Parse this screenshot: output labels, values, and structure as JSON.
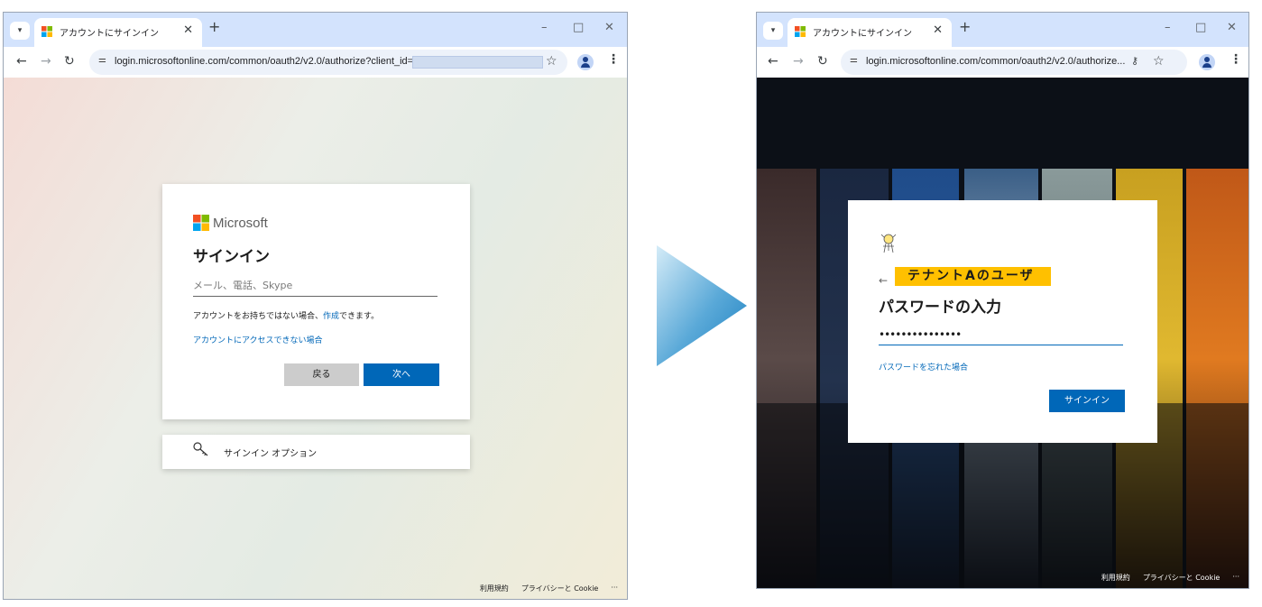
{
  "left_window": {
    "tab_title": "アカウントにサインイン",
    "url": "login.microsoftonline.com/common/oauth2/v2.0/authorize?client_id=",
    "card": {
      "brand": "Microsoft",
      "title": "サインイン",
      "email_placeholder": "メール、電話、Skype",
      "no_account_prefix": "アカウントをお持ちではない場合、",
      "create_link": "作成",
      "no_account_suffix": "できます。",
      "cant_access_link": "アカウントにアクセスできない場合",
      "back_button": "戻る",
      "next_button": "次へ"
    },
    "signin_options": "サインイン オプション",
    "footer": {
      "terms": "利用規約",
      "privacy": "プライバシーと Cookie",
      "more": "···"
    }
  },
  "right_window": {
    "tab_title": "アカウントにサインイン",
    "url": "login.microsoftonline.com/common/oauth2/v2.0/authorize...",
    "card": {
      "tenant_label": "テナントAのユーザ",
      "title": "パスワードの入力",
      "password_value": "•••••••••••••••",
      "forgot_link": "パスワードを忘れた場合",
      "signin_button": "サインイン"
    },
    "footer": {
      "terms": "利用規約",
      "privacy": "プライバシーと Cookie",
      "more": "···"
    }
  },
  "browser": {
    "back_icon": "arrow-left-icon",
    "forward_icon": "arrow-right-icon",
    "reload_icon": "reload-icon",
    "new_tab": "+",
    "minimize": "–",
    "maximize": "□",
    "close": "✕"
  },
  "colors": {
    "accent": "#0067b8",
    "tenant_highlight": "#ffc000",
    "tabbar": "#d3e3fd",
    "arrow_light": "#d5ecf8",
    "arrow_dark": "#1b7fc0"
  }
}
